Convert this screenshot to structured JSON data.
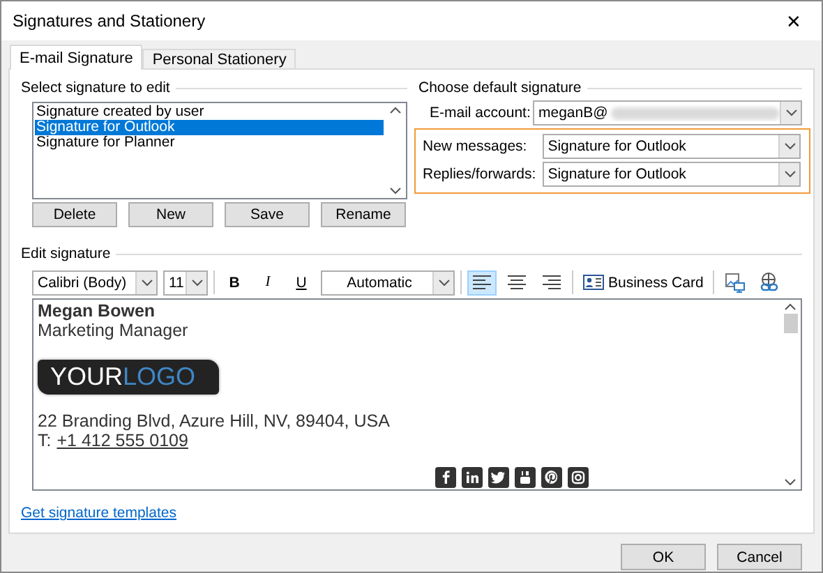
{
  "window": {
    "title": "Signatures and Stationery",
    "close": "✕"
  },
  "tabs": [
    {
      "label": "E-mail Signature",
      "selected": true
    },
    {
      "label": "Personal Stationery",
      "selected": false
    }
  ],
  "select_signature": {
    "heading": "Select signature to edit",
    "items": [
      {
        "label": "Signature created by user",
        "selected": false
      },
      {
        "label": "Signature for Outlook",
        "selected": true
      },
      {
        "label": "Signature for Planner",
        "selected": false
      }
    ],
    "buttons": [
      "Delete",
      "New",
      "Save",
      "Rename"
    ]
  },
  "default_signature": {
    "heading": "Choose default signature",
    "account": {
      "label": "E-mail account:",
      "value": "meganB@"
    },
    "new_messages": {
      "label": "New messages:",
      "value": "Signature for Outlook"
    },
    "replies": {
      "label": "Replies/forwards:",
      "value": "Signature for Outlook"
    }
  },
  "edit_signature": {
    "heading": "Edit signature",
    "toolbar": {
      "font": "Calibri (Body)",
      "size": "11",
      "bold": "B",
      "italic": "I",
      "underline": "U",
      "font_color": "Automatic",
      "align": [
        {
          "kind": "left",
          "selected": true
        },
        {
          "kind": "center",
          "selected": false
        },
        {
          "kind": "right",
          "selected": false
        }
      ],
      "business_card": "Business Card"
    },
    "content": {
      "name": "Megan Bowen",
      "role": "Marketing Manager",
      "logo": [
        {
          "text": "YOUR",
          "color": "#ffffff"
        },
        {
          "text": "LOGO",
          "color": "#3f86c6"
        }
      ],
      "address": "22 Branding Blvd, Azure Hill, NV, 89404, USA",
      "phone_label": "T:",
      "phone": "+1 412 555 0109",
      "social": [
        {
          "kind": "facebook"
        },
        {
          "kind": "linkedin"
        },
        {
          "kind": "twitter"
        },
        {
          "kind": "youtube"
        },
        {
          "kind": "pinterest"
        },
        {
          "kind": "instagram"
        }
      ]
    }
  },
  "templates_link": "Get signature templates",
  "footer_buttons": [
    "OK",
    "Cancel"
  ]
}
